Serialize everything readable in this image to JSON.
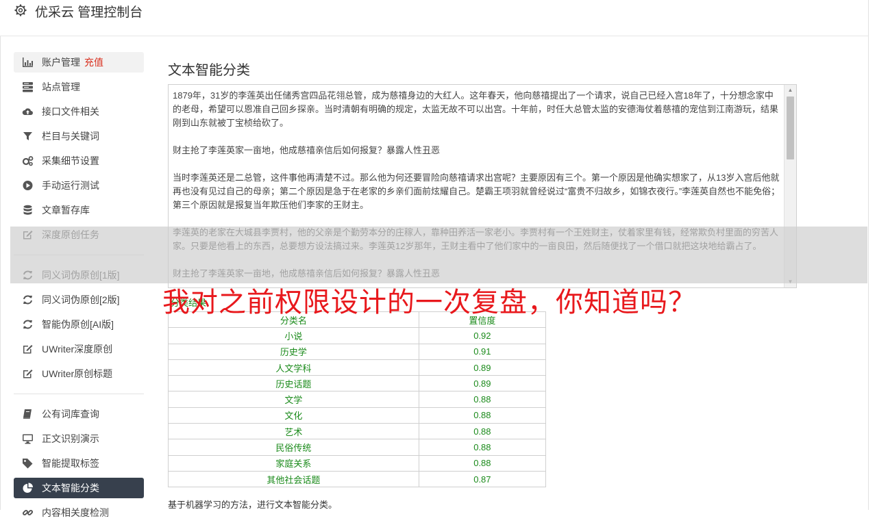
{
  "header": {
    "title": "优采云 管理控制台",
    "icon": "gear-icon"
  },
  "sidebar": {
    "groups": [
      [
        {
          "label": "账户管理",
          "badge": "充值",
          "icon": "bar-chart-icon"
        },
        {
          "label": "站点管理",
          "icon": "server-icon"
        },
        {
          "label": "接口文件相关",
          "icon": "cloud-upload-icon"
        },
        {
          "label": "栏目与关键词",
          "icon": "filter-icon"
        },
        {
          "label": "采集细节设置",
          "icon": "cogs-icon"
        },
        {
          "label": "手动运行测试",
          "icon": "play-circle-icon"
        },
        {
          "label": "文章暂存库",
          "icon": "database-icon"
        },
        {
          "label": "深度原创任务",
          "icon": "edit-icon"
        }
      ],
      [
        {
          "label": "同义词伪原创[1版]",
          "icon": "refresh-icon"
        },
        {
          "label": "同义词伪原创[2版]",
          "icon": "refresh-icon"
        },
        {
          "label": "智能伪原创[AI版]",
          "icon": "refresh-icon"
        },
        {
          "label": "UWriter深度原创",
          "icon": "edit-icon"
        },
        {
          "label": "UWriter原创标题",
          "icon": "edit-icon"
        }
      ],
      [
        {
          "label": "公有词库查询",
          "icon": "book-icon"
        },
        {
          "label": "正文识别演示",
          "icon": "desktop-icon"
        },
        {
          "label": "智能提取标签",
          "icon": "tag-icon"
        },
        {
          "label": "文本智能分类",
          "icon": "pie-chart-icon",
          "active": true
        },
        {
          "label": "内容相关度检测",
          "icon": "link-icon"
        }
      ]
    ]
  },
  "main": {
    "title": "文本智能分类",
    "text_paragraphs": [
      "1879年，31岁的李莲英出任储秀宫四品花翎总管，成为慈禧身边的大红人。这年春天，他向慈禧提出了一个请求，说自己已经入宫18年了，十分想念家中的老母，希望可以恩准自己回乡探亲。当时清朝有明确的规定，太监无故不可以出宫。十年前，时任大总管太监的安德海仗着慈禧的宠信到江南游玩，结果刚到山东就被丁宝桢给砍了。",
      "财主抢了李莲英家一亩地，他成慈禧亲信后如何报复？暴露人性丑恶",
      "当时李莲英还是二总管，这件事他再清楚不过。那么他为何还要冒险向慈禧请求出宫呢？主要原因有三个。第一个原因是他确实想家了，从13岁入宫后他就再也没有见过自己的母亲；第二个原因是急于在老家的乡亲们面前炫耀自己。楚霸王项羽就曾经说过“富贵不归故乡，如锦衣夜行。”李莲英自然也不能免俗；第三个原因就是报复当年欺压他们李家的王财主。",
      "李莲英的老家在大城县李贾村，他的父亲是个勤劳本分的庄稼人，靠种田养活一家老小。李贾村有一个王姓财主，仗着家里有钱，经常欺负村里面的穷苦人家。只要是他看上的东西，总要想方设法搞过来。李莲英12岁那年，王财主看中了他们家中的一亩良田，然后随便找了一个借口就把这块地给霸占了。",
      "财主抢了李莲英家一亩地，他成慈禧亲信后如何报复？暴露人性丑恶"
    ],
    "result_label": "分类结果",
    "table": {
      "headers": [
        "分类名",
        "置信度"
      ],
      "rows": [
        [
          "小说",
          "0.92"
        ],
        [
          "历史学",
          "0.91"
        ],
        [
          "人文学科",
          "0.89"
        ],
        [
          "历史话题",
          "0.89"
        ],
        [
          "文学",
          "0.88"
        ],
        [
          "文化",
          "0.88"
        ],
        [
          "艺术",
          "0.88"
        ],
        [
          "民俗传统",
          "0.88"
        ],
        [
          "家庭关系",
          "0.88"
        ],
        [
          "其他社会话题",
          "0.87"
        ]
      ]
    },
    "note": "基于机器学习的方法，进行文本智能分类。"
  },
  "overlay": {
    "caption": "我对之前权限设计的一次复盘，你知道吗？"
  },
  "colors": {
    "accent_red": "#d9301f",
    "active_nav": "#37404d",
    "result_green": "#1a8a1a",
    "caption_red": "#e8181c"
  }
}
